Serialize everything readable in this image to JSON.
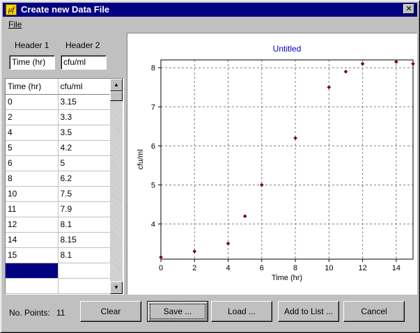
{
  "window": {
    "title": "Create new Data File",
    "app_icon_label": "μf",
    "close_glyph": "✕"
  },
  "menu": {
    "file": "File"
  },
  "headers": {
    "header1_label": "Header 1",
    "header2_label": "Header 2",
    "header1_value": "Time (hr)",
    "header2_value": "cfu/ml"
  },
  "grid": {
    "columns": [
      "Time (hr)",
      "cfu/ml"
    ],
    "rows": [
      [
        "0",
        "3.15"
      ],
      [
        "2",
        "3.3"
      ],
      [
        "4",
        "3.5"
      ],
      [
        "5",
        "4.2"
      ],
      [
        "6",
        "5"
      ],
      [
        "8",
        "6.2"
      ],
      [
        "10",
        "7.5"
      ],
      [
        "11",
        "7.9"
      ],
      [
        "12",
        "8.1"
      ],
      [
        "14",
        "8.15"
      ],
      [
        "15",
        "8.1"
      ]
    ]
  },
  "chart_data": {
    "type": "scatter",
    "title": "Untitled",
    "xlabel": "Time (hr)",
    "ylabel": "cfu/ml",
    "x": [
      0,
      2,
      4,
      5,
      6,
      8,
      10,
      11,
      12,
      14,
      15
    ],
    "y": [
      3.15,
      3.3,
      3.5,
      4.2,
      5,
      6.2,
      7.5,
      7.9,
      8.1,
      8.15,
      8.1
    ],
    "xlim": [
      0,
      15
    ],
    "ylim": [
      3.1,
      8.2
    ],
    "xticks": [
      0,
      2,
      4,
      6,
      8,
      10,
      12,
      14
    ],
    "yticks": [
      4,
      5,
      6,
      7,
      8
    ],
    "grid": true,
    "marker_color": "#800000",
    "title_color": "#0000c0"
  },
  "footer": {
    "points_label": "No. Points:",
    "points_value": "11",
    "clear": "Clear",
    "save": "Save ...",
    "load": "Load ...",
    "add_to_list": "Add to List ...",
    "cancel": "Cancel"
  }
}
